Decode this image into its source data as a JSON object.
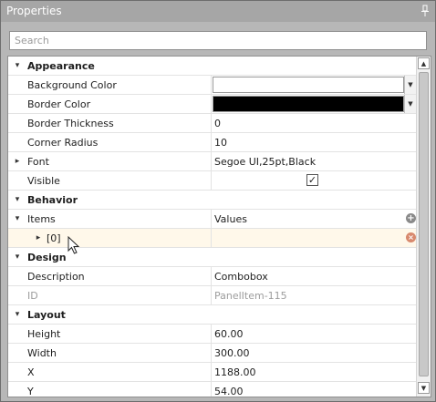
{
  "panel": {
    "title": "Properties",
    "pin_icon": "pin-icon",
    "search": {
      "placeholder": "Search",
      "value": ""
    }
  },
  "categories": [
    {
      "name": "Appearance",
      "expanded": true,
      "properties": [
        {
          "label": "Background Color",
          "type": "color",
          "color": "#ffffff"
        },
        {
          "label": "Border Color",
          "type": "color",
          "color": "#000000"
        },
        {
          "label": "Border Thickness",
          "type": "text",
          "value": "0"
        },
        {
          "label": "Corner Radius",
          "type": "text",
          "value": "10"
        },
        {
          "label": "Font",
          "type": "text",
          "value": "Segoe UI,25pt,Black",
          "expandable": true
        },
        {
          "label": "Visible",
          "type": "checkbox",
          "checked": true
        }
      ]
    },
    {
      "name": "Behavior",
      "expanded": true,
      "properties": [
        {
          "label": "Items",
          "type": "collection",
          "value": "Values",
          "expanded": true,
          "children": [
            {
              "label": "[0]"
            }
          ]
        }
      ]
    },
    {
      "name": "Design",
      "expanded": true,
      "properties": [
        {
          "label": "Description",
          "type": "text",
          "value": "Combobox"
        },
        {
          "label": "ID",
          "type": "text",
          "value": "PanelItem-115",
          "disabled": true
        }
      ]
    },
    {
      "name": "Layout",
      "expanded": true,
      "properties": [
        {
          "label": "Height",
          "type": "text",
          "value": "60.00"
        },
        {
          "label": "Width",
          "type": "text",
          "value": "300.00"
        },
        {
          "label": "X",
          "type": "text",
          "value": "1188.00"
        },
        {
          "label": "Y",
          "type": "text",
          "value": "54.00"
        }
      ]
    }
  ],
  "glyphs": {
    "expanded": "▾",
    "collapsed": "▸",
    "dropdown": "▼",
    "check": "✓",
    "add": "+",
    "remove": "×",
    "scroll_up": "▲",
    "scroll_down": "▼"
  },
  "colors": {
    "titlebar": "#a6a6a6",
    "panel_bg": "#b7b7b7",
    "highlight_row": "#fff8ea",
    "remove_icon": "#d8896e"
  }
}
